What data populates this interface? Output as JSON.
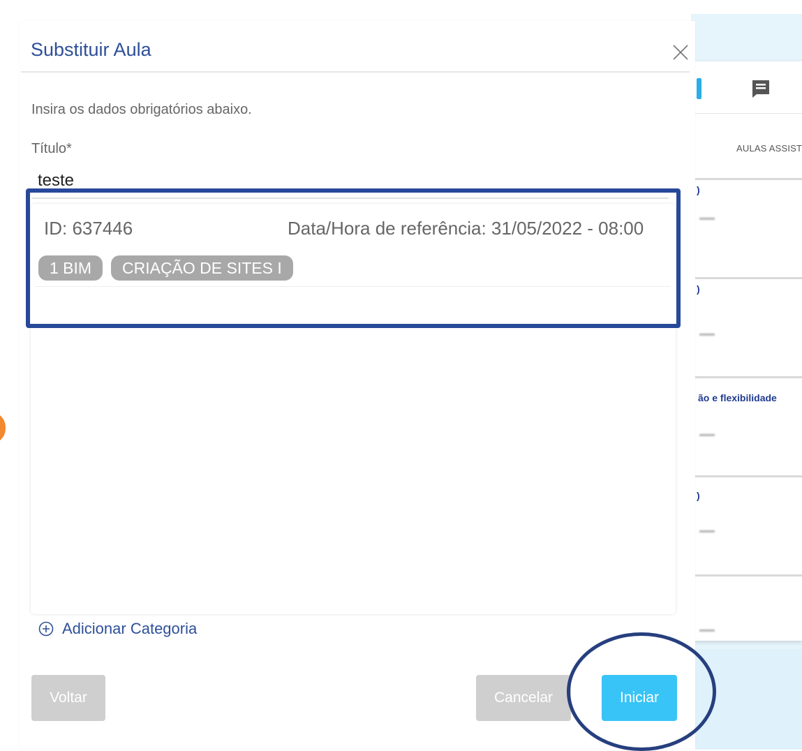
{
  "modal": {
    "title": "Substituir Aula",
    "instructions": "Insira os dados obrigatórios abaixo.",
    "title_field": {
      "label": "Título*",
      "value": "teste"
    },
    "selected_item": {
      "id": "ID: 637446",
      "reference": "Data/Hora de referência: 31/05/2022 - 08:00",
      "tags": [
        "1 BIM",
        "CRIAÇÃO DE SITES I"
      ]
    },
    "add_category_label": "Adicionar Categoria",
    "buttons": {
      "back": "Voltar",
      "cancel": "Cancelar",
      "start": "Iniciar"
    }
  },
  "background": {
    "tab_label": "AULAS ASSIST",
    "row_marks": [
      ")",
      ")",
      "ão e flexibilidade",
      ")"
    ],
    "accent_blue": "#27aee8"
  },
  "colors": {
    "title_blue": "#2e4f98",
    "highlight_border": "#28499a",
    "primary_button": "#38c4f6",
    "disabled_button": "#cfcfcf",
    "chip": "#a8a8a8"
  },
  "icons": {
    "close": "close-icon",
    "add": "plus-circle-icon",
    "chat": "chat-icon"
  }
}
